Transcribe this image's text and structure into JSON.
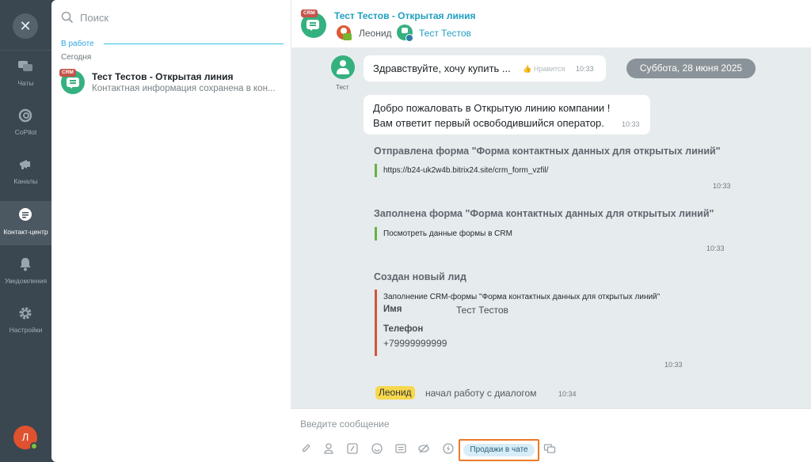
{
  "rail": {
    "close_glyph": "✕",
    "items": [
      {
        "label": "Чаты",
        "icon": "chats-icon"
      },
      {
        "label": "CoPilot",
        "icon": "copilot-icon"
      },
      {
        "label": "Каналы",
        "icon": "megaphone-icon"
      },
      {
        "label": "Контакт-центр",
        "icon": "contact-center-icon",
        "active": true
      },
      {
        "label": "Уведомления",
        "icon": "bell-icon"
      },
      {
        "label": "Настройки",
        "icon": "gear-icon"
      }
    ],
    "user_initial": "Л"
  },
  "list": {
    "search_placeholder": "Поиск",
    "group_title": "В работе",
    "today": "Сегодня",
    "items": [
      {
        "crm": "CRM",
        "name": "Тест Тестов - Открытая линия",
        "preview": "Контактная информация сохранена в кон..."
      }
    ]
  },
  "header": {
    "crm": "CRM",
    "title": "Тест Тестов - Открытая линия",
    "operator": "Леонид",
    "client": "Тест Тестов"
  },
  "messages": {
    "user_label": "Тест",
    "m1": {
      "text": "Здравствуйте, хочу купить ...",
      "like": "Нравится",
      "time": "10:33"
    },
    "date": "Суббота, 28 июня 2025",
    "m2": {
      "line1": "Добро пожаловать в Открытую линию компании !",
      "line2": "Вам ответит первый освободившийся оператор.",
      "time": "10:33"
    },
    "s1": {
      "title": "Отправлена форма \"Форма контактных данных для открытых линий\"",
      "link": "https://b24-uk2w4b.bitrix24.site/crm_form_vzfil/",
      "time": "10:33"
    },
    "s2": {
      "title": "Заполнена форма \"Форма контактных данных для открытых линий\"",
      "link": "Посмотреть данные формы в CRM",
      "time": "10:33"
    },
    "s3": {
      "title": "Создан новый лид",
      "desc": "Заполнение CRM-формы \"Форма контактных данных для открытых линий\"",
      "name_label": "Имя",
      "name_value": "Тест Тестов",
      "phone_label": "Телефон",
      "phone_value": "+79999999999",
      "time": "10:33"
    },
    "started": {
      "operator": "Леонид",
      "text": "начал работу с диалогом",
      "time": "10:34"
    }
  },
  "composer": {
    "placeholder": "Введите сообщение",
    "sales_label": "Продажи в чате",
    "tools": [
      "paperclip-icon",
      "person-icon",
      "form-icon",
      "smile-icon",
      "quick-answer-icon",
      "hide-icon",
      "lightning-icon",
      "transfer-icon"
    ]
  },
  "colors": {
    "accent": "#1f9ec1",
    "rail": "#3a4650",
    "crm": "#c6534a",
    "openline": "#35b17f",
    "highlight": "#ed7a27"
  }
}
